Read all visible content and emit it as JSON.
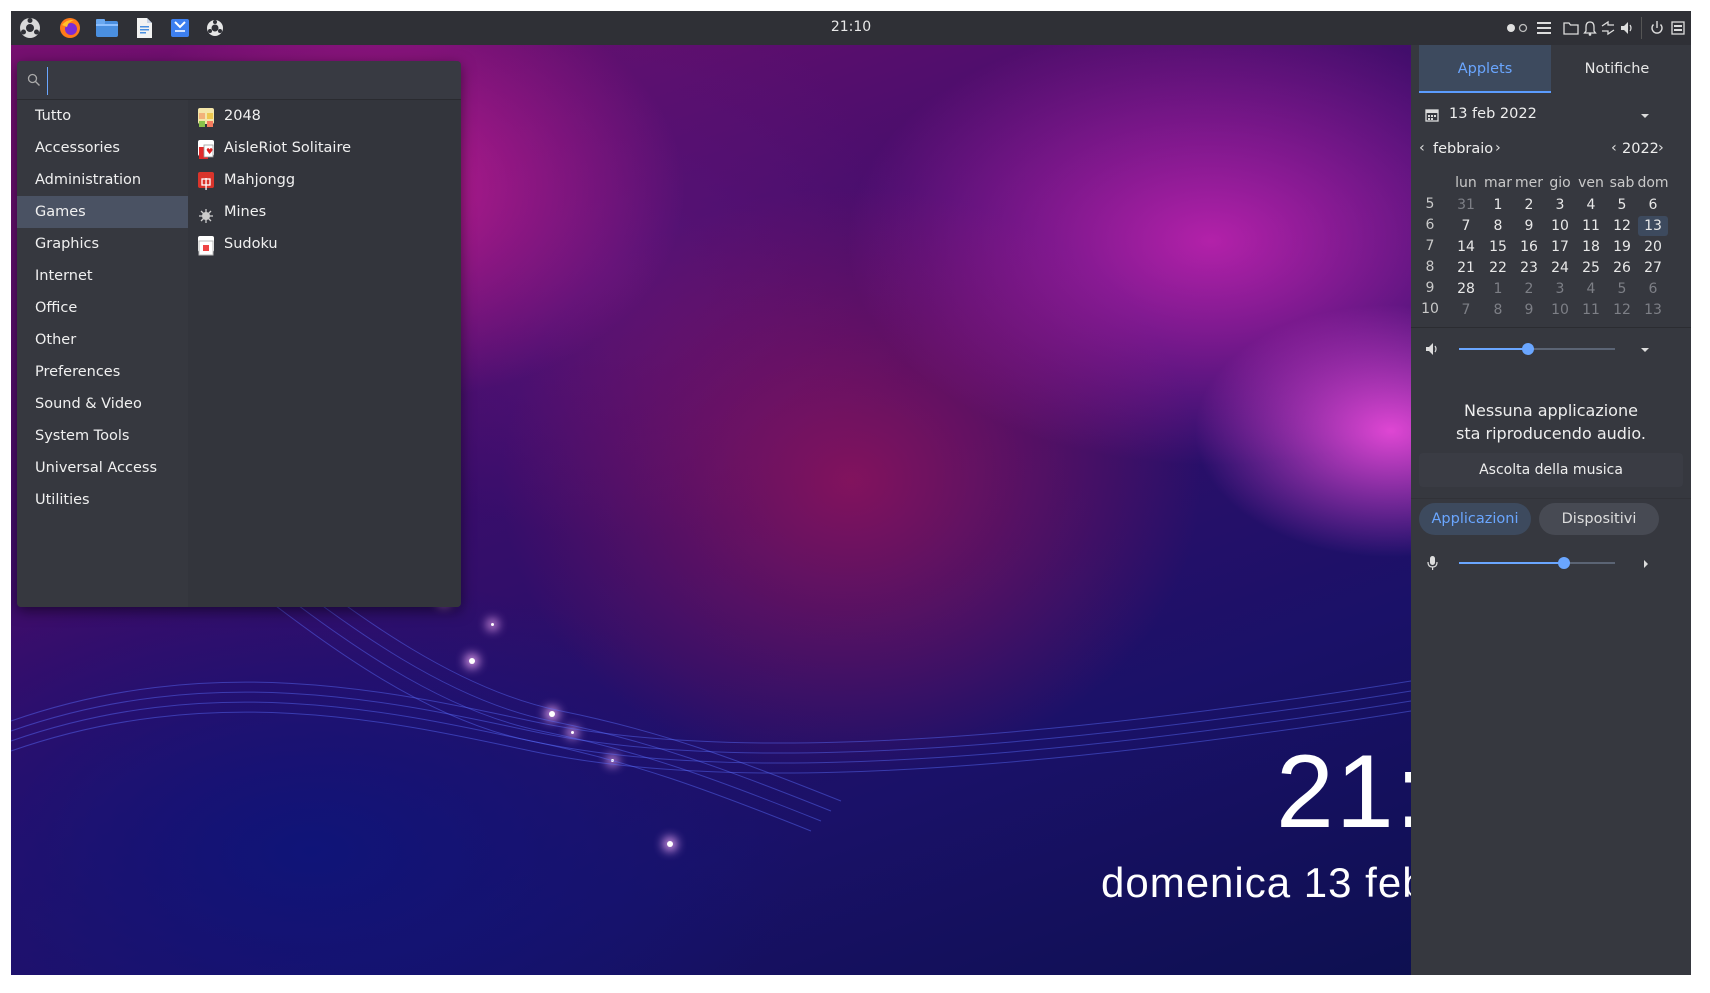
{
  "topbar": {
    "clock": "21:10",
    "launchers": [
      "system-menu-icon",
      "firefox-icon",
      "files-icon",
      "text-editor-icon",
      "mail-icon",
      "ubuntu-logo-icon"
    ]
  },
  "menu": {
    "search_placeholder": "",
    "categories": [
      "Tutto",
      "Accessories",
      "Administration",
      "Games",
      "Graphics",
      "Internet",
      "Office",
      "Other",
      "Preferences",
      "Sound & Video",
      "System Tools",
      "Universal Access",
      "Utilities"
    ],
    "selected_category": "Games",
    "apps": [
      {
        "label": "2048",
        "icon": "game-2048-icon"
      },
      {
        "label": "AisleRiot Solitaire",
        "icon": "cards-icon"
      },
      {
        "label": "Mahjongg",
        "icon": "mahjongg-icon"
      },
      {
        "label": "Mines",
        "icon": "mines-icon"
      },
      {
        "label": "Sudoku",
        "icon": "sudoku-icon"
      }
    ]
  },
  "desktop": {
    "clock": "21:",
    "date": "domenica 13 feb"
  },
  "panel": {
    "tabs": [
      "Applets",
      "Notifiche"
    ],
    "active_tab": "Applets",
    "date_label": "13 feb 2022",
    "month": "febbraio",
    "year": "2022",
    "weekdays": [
      "lun",
      "mar",
      "mer",
      "gio",
      "ven",
      "sab",
      "dom"
    ],
    "weeks": [
      {
        "num": "5",
        "days": [
          "31",
          "1",
          "2",
          "3",
          "4",
          "5",
          "6"
        ]
      },
      {
        "num": "6",
        "days": [
          "7",
          "8",
          "9",
          "10",
          "11",
          "12",
          "13"
        ]
      },
      {
        "num": "7",
        "days": [
          "14",
          "15",
          "16",
          "17",
          "18",
          "19",
          "20"
        ]
      },
      {
        "num": "8",
        "days": [
          "21",
          "22",
          "23",
          "24",
          "25",
          "26",
          "27"
        ]
      },
      {
        "num": "9",
        "days": [
          "28",
          "1",
          "2",
          "3",
          "4",
          "5",
          "6"
        ]
      },
      {
        "num": "10",
        "days": [
          "7",
          "8",
          "9",
          "10",
          "11",
          "12",
          "13"
        ]
      }
    ],
    "today": "13",
    "volume_level": 0.44,
    "no_audio_line1": "Nessuna applicazione",
    "no_audio_line2": "sta riproducendo audio.",
    "listen_music": "Ascolta della musica",
    "audio_tabs": [
      "Applicazioni",
      "Dispositivi"
    ],
    "mic_level": 0.67,
    "accent": "#6aa6ff"
  }
}
